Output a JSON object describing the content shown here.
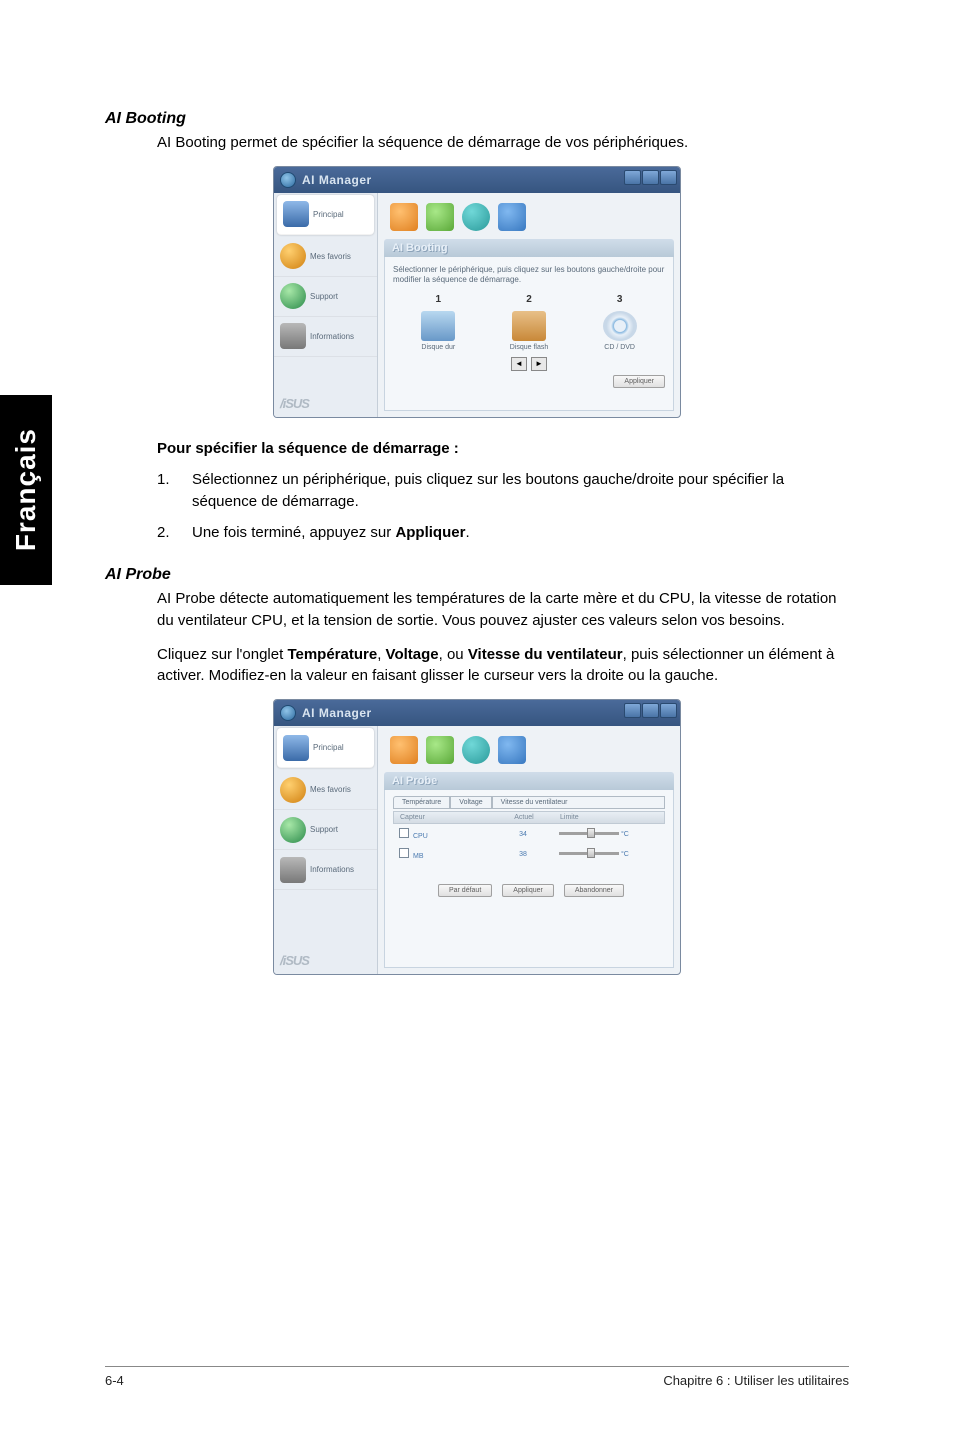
{
  "sideTab": "Français",
  "sections": {
    "aibooting": {
      "title": "AI Booting",
      "intro": "AI Booting permet de spécifier la séquence de démarrage de vos périphériques.",
      "instructionsHeading": "Pour spécifier la séquence de démarrage :",
      "step1num": "1.",
      "step1": "Sélectionnez un périphérique, puis cliquez sur les boutons gauche/droite pour spécifier la séquence de démarrage.",
      "step2num": "2.",
      "step2pre": "Une fois terminé, appuyez sur ",
      "step2bold": "Appliquer",
      "step2post": "."
    },
    "aiprobe": {
      "title": "AI Probe",
      "para1": "AI Probe détecte automatiquement les températures de la carte mère et du CPU, la vitesse de rotation du ventilateur CPU, et la tension de sortie. Vous pouvez ajuster ces valeurs selon vos besoins.",
      "para2pre": "Cliquez sur l'onglet ",
      "para2b1": "Température",
      "para2m1": ", ",
      "para2b2": "Voltage",
      "para2m2": ", ou ",
      "para2b3": "Vitesse du ventilateur",
      "para2post": ", puis sélectionner un élément à activer. Modifiez-en la valeur en faisant glisser le curseur vers la droite ou la gauche."
    }
  },
  "app": {
    "title": "AI Manager",
    "sidebar": {
      "principal": "Principal",
      "favoris": "Mes favoris",
      "support": "Support",
      "informations": "Informations",
      "logo": "/iSUS"
    },
    "booting": {
      "header": "AI Booting",
      "helper": "Sélectionner le périphérique, puis cliquez sur les boutons gauche/droite pour modifier la séquence de démarrage.",
      "col1num": "1",
      "col2num": "2",
      "col3num": "3",
      "col1label": "Disque dur",
      "col2label": "Disque flash",
      "col3label": "CD / DVD",
      "arrowLeft": "◄",
      "arrowRight": "►",
      "applyBtn": "Appliquer"
    },
    "probe": {
      "header": "AI Probe",
      "tab1": "Température",
      "tab2": "Voltage",
      "tab3": "Vitesse du ventilateur",
      "colSensor": "Capteur",
      "colActual": "Actuel",
      "colLimit": "Limite",
      "row1name": "CPU",
      "row1val": "34",
      "row1unit": "°C",
      "row2name": "MB",
      "row2val": "38",
      "row2unit": "°C",
      "btn1": "Par défaut",
      "btn2": "Appliquer",
      "btn3": "Abandonner"
    }
  },
  "footer": {
    "pageNum": "6-4",
    "chapter": "Chapitre 6 : Utiliser les utilitaires"
  }
}
